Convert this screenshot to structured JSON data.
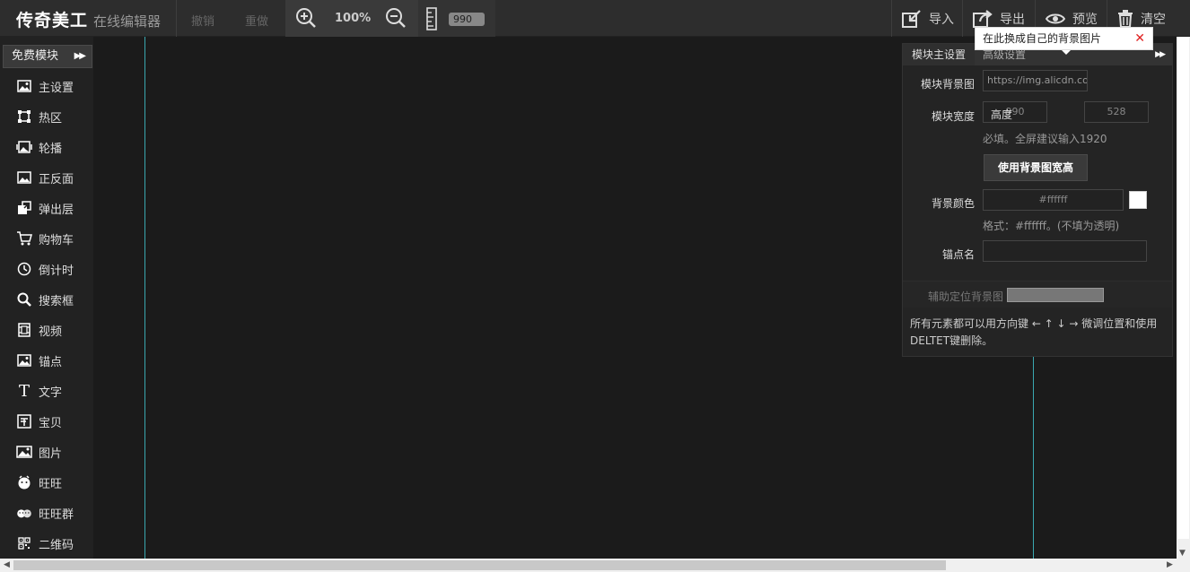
{
  "app": {
    "logo": "传奇美工",
    "subtitle": "在线编辑器"
  },
  "toolbar": {
    "undo": "撤销",
    "redo": "重做",
    "zoom": "100%",
    "width": "990",
    "import": "导入",
    "export": "导出",
    "preview": "预览",
    "clear": "清空"
  },
  "sidebar": {
    "header": "免费模块",
    "header_arrows": "▶▶",
    "items": [
      {
        "label": "主设置",
        "icon": "image-icon"
      },
      {
        "label": "热区",
        "icon": "hotspot-icon"
      },
      {
        "label": "轮播",
        "icon": "carousel-icon"
      },
      {
        "label": "正反面",
        "icon": "flip-icon"
      },
      {
        "label": "弹出层",
        "icon": "popup-icon"
      },
      {
        "label": "购物车",
        "icon": "cart-icon"
      },
      {
        "label": "倒计时",
        "icon": "clock-icon"
      },
      {
        "label": "搜索框",
        "icon": "search-icon"
      },
      {
        "label": "视频",
        "icon": "video-icon"
      },
      {
        "label": "锚点",
        "icon": "anchor-icon"
      },
      {
        "label": "文字",
        "icon": "text-icon"
      },
      {
        "label": "宝贝",
        "icon": "product-icon"
      },
      {
        "label": "图片",
        "icon": "picture-icon"
      },
      {
        "label": "旺旺",
        "icon": "wangwang-icon"
      },
      {
        "label": "旺旺群",
        "icon": "wangwang-group-icon"
      },
      {
        "label": "二维码",
        "icon": "qrcode-icon"
      }
    ]
  },
  "panel": {
    "tab_main": "模块主设置",
    "tab_advanced": "高级设置",
    "tab_arrows": "▶▶",
    "bg_image_label": "模块背景图",
    "bg_image_value": "https://img.alicdn.cor",
    "width_label": "模块宽度",
    "width_value": "990",
    "height_label": "高度",
    "height_value": "528",
    "width_hint": "必填。全屏建议输入1920",
    "use_bg_size_button": "使用背景图宽高",
    "bg_color_label": "背景颜色",
    "bg_color_value": "#ffffff",
    "bg_color_hint": "格式：#ffffff。(不填为透明)",
    "anchor_label": "锚点名",
    "anchor_value": "",
    "aux_bg_label": "辅助定位背景图",
    "note": "所有元素都可以用方向键 ← ↑ ↓ → 微调位置和使用DELTET键删除。"
  },
  "tooltip": {
    "text": "在此换成自己的背景图片",
    "close": "✕"
  },
  "colors": {
    "guide": "#3aa8b0",
    "accent_red": "#e02020"
  }
}
